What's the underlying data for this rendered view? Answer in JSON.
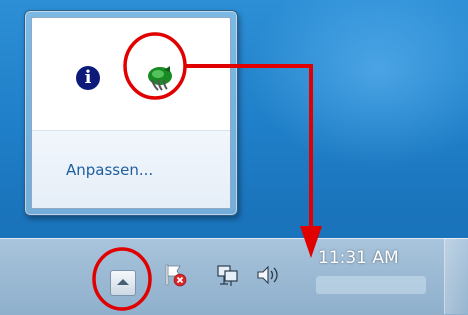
{
  "flyout": {
    "customize_label": "Anpassen...",
    "icons": [
      {
        "name": "info-icon",
        "glyph": "i"
      },
      {
        "name": "app-icon"
      }
    ]
  },
  "taskbar": {
    "clock_time": "11:31 AM",
    "tray_icons": [
      "show-hidden-icons-arrow",
      "action-center-flag-icon",
      "network-icon",
      "volume-icon"
    ]
  },
  "annotation": {
    "color": "#e00000"
  }
}
